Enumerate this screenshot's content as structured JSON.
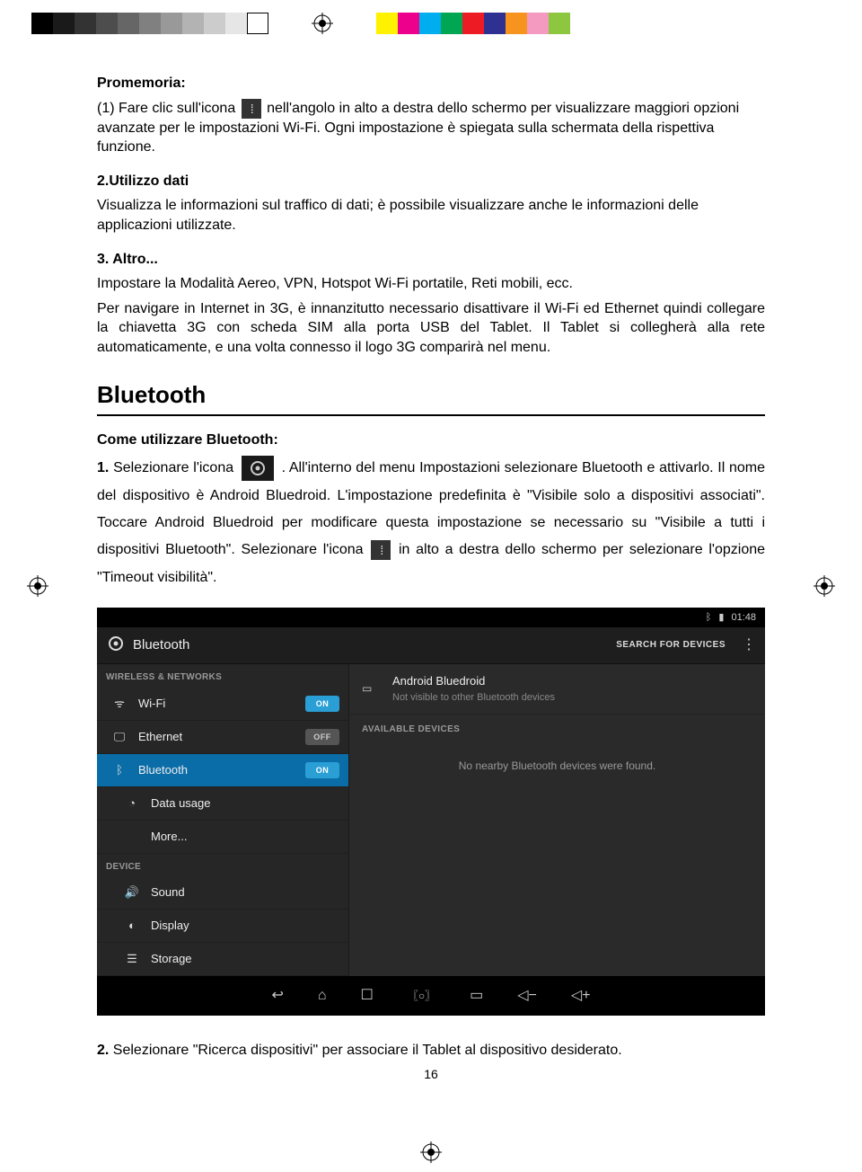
{
  "printbar": {
    "colors": [
      "#000000",
      "#1a1a1a",
      "#333333",
      "#4d4d4d",
      "#666666",
      "#808080",
      "#999999",
      "#b3b3b3",
      "#cccccc",
      "#e6e6e6",
      "#ffffff"
    ],
    "colors2": [
      "#fff200",
      "#ec008c",
      "#00aeef",
      "#00a651",
      "#ed1c24",
      "#2e3192",
      "#f7941d",
      "#f49ac1",
      "#8dc63f"
    ]
  },
  "promemoria": {
    "heading": "Promemoria:",
    "line1a": "(1) Fare clic sull'icona ",
    "line1b": " nell'angolo in alto a destra dello schermo per visualizzare maggiori opzioni avanzate per le impostazioni Wi-Fi. Ogni impostazione è spiegata sulla schermata della rispettiva funzione."
  },
  "sec2": {
    "heading": "2.Utilizzo dati",
    "body": "Visualizza le informazioni sul traffico di dati; è possibile visualizzare anche le informazioni delle applicazioni utilizzate."
  },
  "sec3": {
    "heading": "3. Altro...",
    "body1": "Impostare la Modalità Aereo, VPN, Hotspot Wi-Fi portatile, Reti mobili, ecc.",
    "body2": "Per navigare in Internet in 3G, è innanzitutto necessario disattivare il Wi-Fi ed Ethernet quindi collegare la chiavetta 3G con scheda SIM alla porta USB del Tablet. Il Tablet si collegherà alla rete automaticamente, e una volta connesso il logo 3G comparirà nel menu."
  },
  "bluetooth": {
    "title": "Bluetooth",
    "howto_heading": "Come utilizzare Bluetooth:",
    "step1_lead": "1.",
    "step1_a": " Selezionare l'icona ",
    "step1_b": ". All'interno del menu Impostazioni selezionare Bluetooth e attivarlo. Il nome del dispositivo è Android Bluedroid. L'impostazione predefinita è \"Visibile solo a dispositivi associati\". Toccare Android Bluedroid per modificare questa impostazione se necessario su \"Visibile a tutti i dispositivi Bluetooth\". Selezionare l'icona ",
    "step1_c": " in alto a destra dello schermo per selezionare l'opzione \"Timeout visibilità\".",
    "step2_lead": "2.",
    "step2": " Selezionare \"Ricerca dispositivi\" per associare il Tablet al dispositivo desiderato."
  },
  "shot": {
    "time": "01:48",
    "title": "Bluetooth",
    "search": "SEARCH FOR DEVICES",
    "wireless_header": "WIRELESS & NETWORKS",
    "device_header": "DEVICE",
    "items": {
      "wifi": "Wi-Fi",
      "ethernet": "Ethernet",
      "bluetooth": "Bluetooth",
      "datausage": "Data usage",
      "more": "More...",
      "sound": "Sound",
      "display": "Display",
      "storage": "Storage"
    },
    "toggle_on": "ON",
    "toggle_off": "OFF",
    "device_name": "Android Bluedroid",
    "device_sub": "Not visible to other Bluetooth devices",
    "avail_header": "AVAILABLE DEVICES",
    "no_devices": "No nearby Bluetooth devices were found."
  },
  "page_number": "16"
}
